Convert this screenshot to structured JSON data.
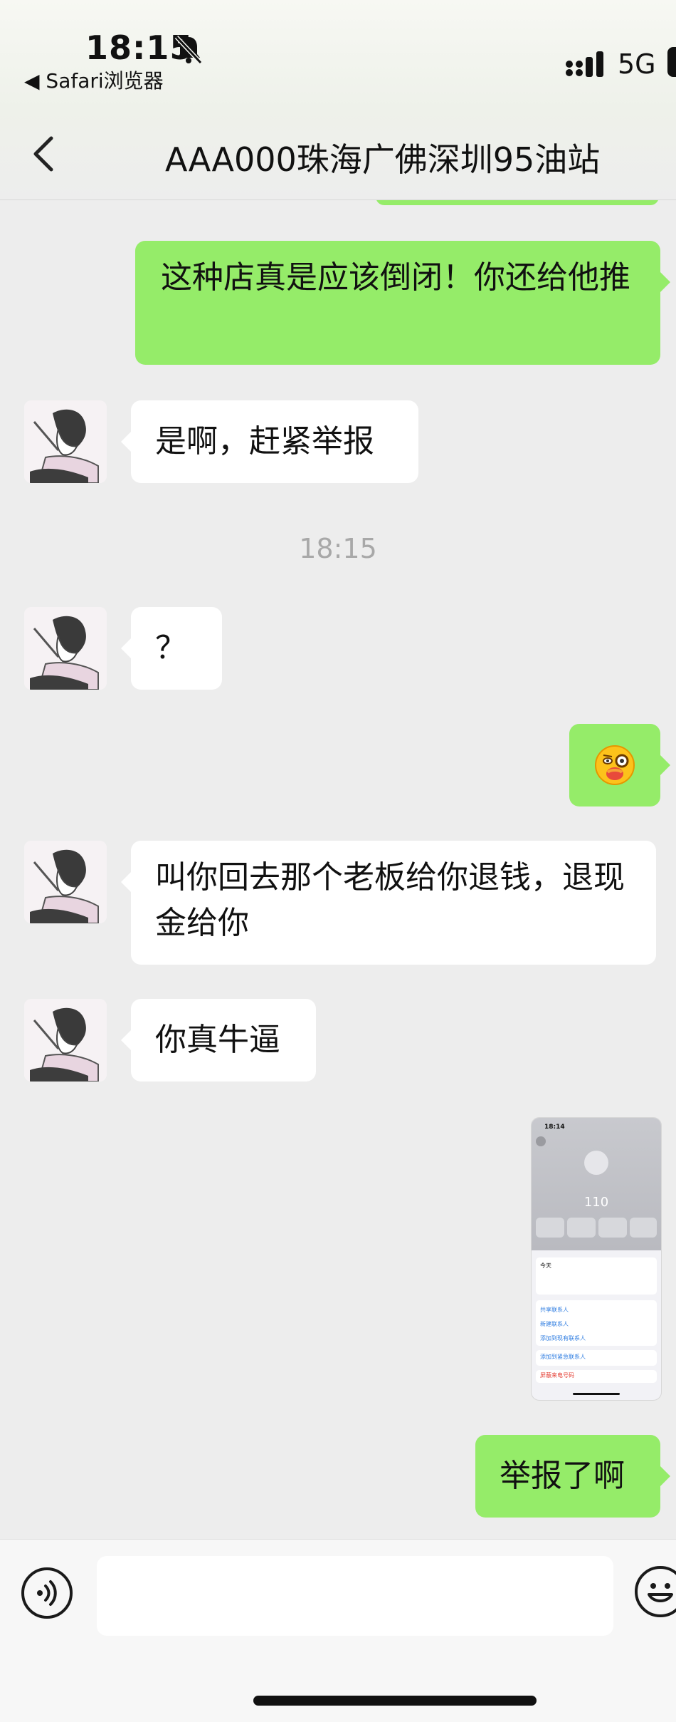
{
  "status_bar": {
    "time": "18:15",
    "back_app": "◀ Safari浏览器",
    "network": "5G"
  },
  "nav": {
    "title": "AAA000珠海广佛深圳95油站"
  },
  "messages": [
    {
      "direction": "out",
      "text": "这种店真是应该倒闭！你还给他推"
    },
    {
      "direction": "in",
      "text": "是啊，赶紧举报"
    },
    {
      "direction": "in",
      "text": "？"
    },
    {
      "direction": "out",
      "type": "emoji",
      "emoji": "face-with-monocle-and-hand-over-mouth"
    },
    {
      "direction": "in",
      "text": "叫你回去那个老板给你退钱，退现金给你"
    },
    {
      "direction": "in",
      "text": "你真牛逼"
    },
    {
      "direction": "out",
      "type": "image"
    },
    {
      "direction": "out",
      "text": "举报了啊"
    }
  ],
  "timestamp": "18:15",
  "screenshot_preview": {
    "time": "18:14",
    "number": "110",
    "items": [
      "今天",
      "共享联系人",
      "新建联系人",
      "添加到现有联系人",
      "添加到紧急联系人",
      "屏蔽来电号码"
    ]
  },
  "input_bar": {
    "placeholder": ""
  },
  "colors": {
    "out_bubble": "#95ec69",
    "in_bubble": "#ffffff",
    "background": "#ededed",
    "timestamp": "#a8a8a8"
  }
}
